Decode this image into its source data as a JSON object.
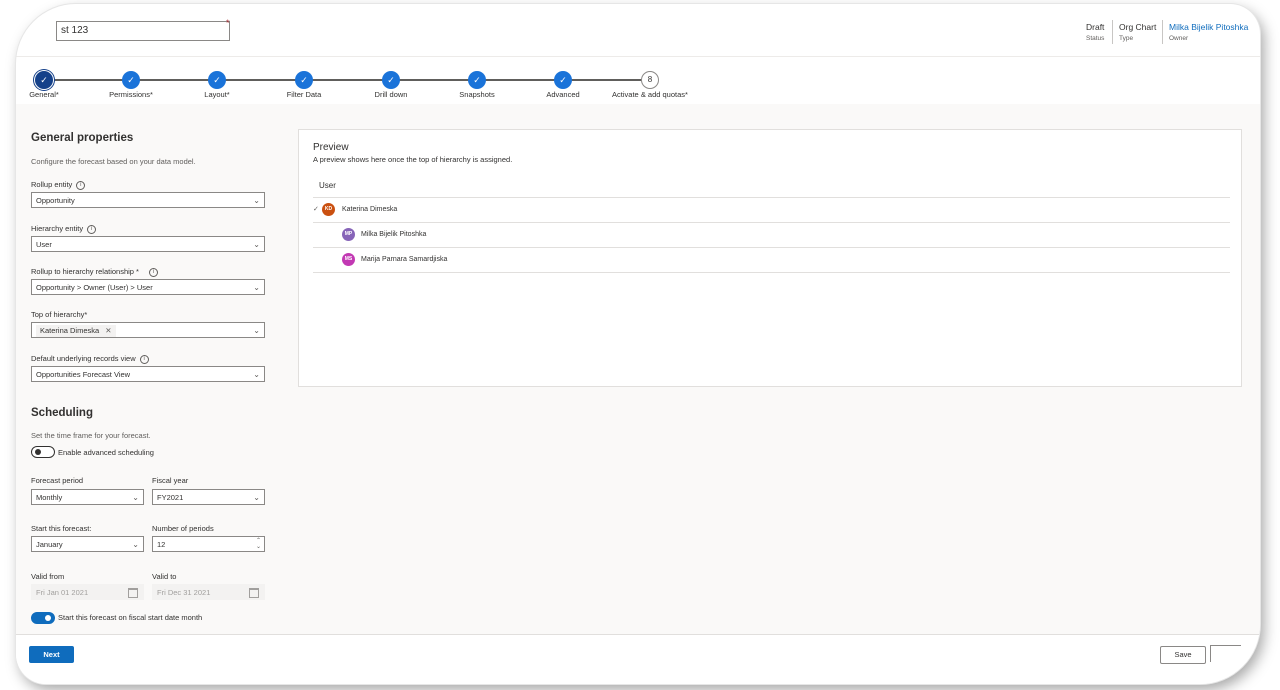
{
  "header": {
    "forecast_name": "st 123",
    "status_value": "Draft",
    "status_label": "Status",
    "type_value": "Org Chart",
    "type_label": "Type",
    "owner_value": "Milka Bijelik Pitoshka",
    "owner_label": "Owner"
  },
  "steps": [
    {
      "label": "General*",
      "state": "current"
    },
    {
      "label": "Permissions*",
      "state": "complete"
    },
    {
      "label": "Layout*",
      "state": "complete"
    },
    {
      "label": "Filter Data",
      "state": "complete"
    },
    {
      "label": "Drill down",
      "state": "complete"
    },
    {
      "label": "Snapshots",
      "state": "complete"
    },
    {
      "label": "Advanced",
      "state": "complete"
    },
    {
      "label": "Activate & add quotas*",
      "state": "open",
      "number": "8"
    }
  ],
  "general": {
    "title": "General properties",
    "description": "Configure the forecast based on your data model.",
    "rollup_entity_label": "Rollup entity",
    "rollup_entity_value": "Opportunity",
    "hierarchy_entity_label": "Hierarchy entity",
    "hierarchy_entity_value": "User",
    "relationship_label": "Rollup to hierarchy relationship *",
    "relationship_value": "Opportunity > Owner (User) > User",
    "top_label": "Top of hierarchy*",
    "top_value": "Katerina Dimeska",
    "view_label": "Default underlying records view",
    "view_value": "Opportunities Forecast View"
  },
  "scheduling": {
    "title": "Scheduling",
    "description": "Set the time frame for your forecast.",
    "advanced_toggle_label": "Enable advanced scheduling",
    "advanced_toggle_on": false,
    "period_label": "Forecast period",
    "period_value": "Monthly",
    "fiscal_label": "Fiscal year",
    "fiscal_value": "FY2021",
    "start_label": "Start this forecast:",
    "start_value": "January",
    "num_periods_label": "Number of periods",
    "num_periods_value": "12",
    "valid_from_label": "Valid from",
    "valid_from_value": "Fri Jan 01 2021",
    "valid_to_label": "Valid to",
    "valid_to_value": "Fri Dec 31 2021",
    "fiscal_start_label": "Start this forecast on fiscal start date month",
    "fiscal_start_on": true
  },
  "preview": {
    "title": "Preview",
    "subtitle": "A preview shows here once the top of hierarchy is assigned.",
    "column": "User",
    "rows": [
      {
        "initials": "KD",
        "name": "Katerina Dimeska",
        "color": "#ca5010",
        "level": 0
      },
      {
        "initials": "MP",
        "name": "Milka Bijelik Pitoshka",
        "color": "#8764b8",
        "level": 1
      },
      {
        "initials": "MS",
        "name": "Marija Parnara Samardjiska",
        "color": "#c239b3",
        "level": 1
      }
    ]
  },
  "footer": {
    "next_label": "Next",
    "save_label": "Save"
  },
  "colors": {
    "accent": "#0f6cbd",
    "step_complete": "#1a73d9",
    "step_current": "#15418a"
  }
}
